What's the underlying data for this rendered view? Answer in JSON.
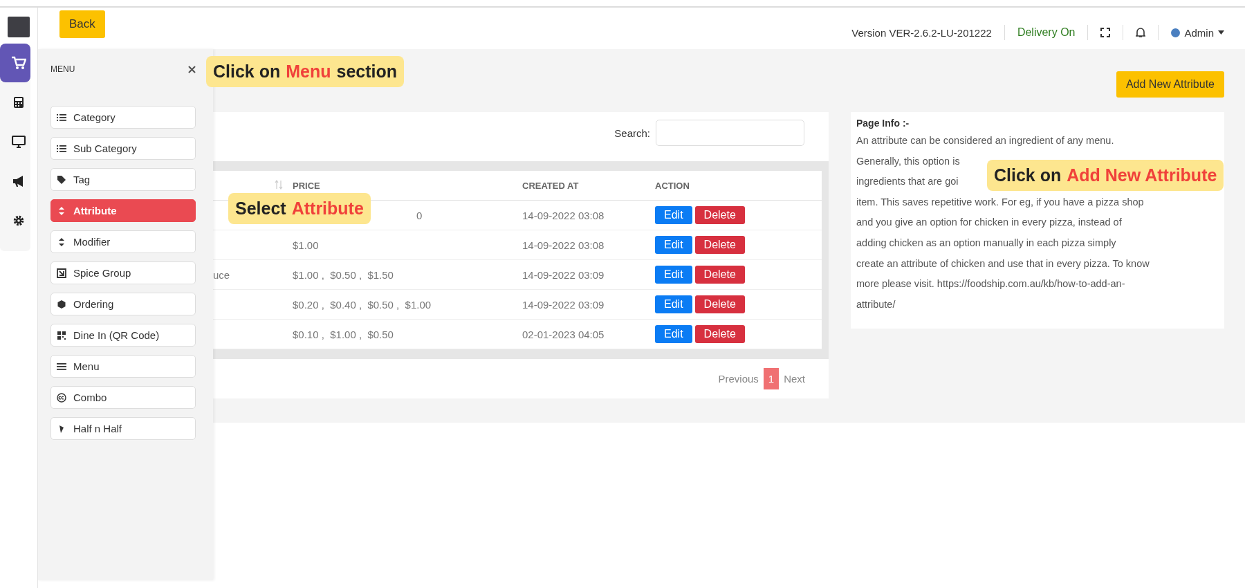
{
  "header": {
    "back_button": "Back",
    "version": "Version VER-2.6.2-LU-201222",
    "delivery_status": "Delivery On",
    "user": "Admin"
  },
  "rail": [
    {
      "selected": true
    },
    {
      "selected": false
    },
    {
      "selected": false
    },
    {
      "selected": false
    },
    {
      "selected": false
    }
  ],
  "drawer": {
    "title": "MENU",
    "items": [
      {
        "label": "Category",
        "selected": false
      },
      {
        "label": "Sub Category",
        "selected": false
      },
      {
        "label": "Tag",
        "selected": false
      },
      {
        "label": "Attribute",
        "selected": true
      },
      {
        "label": "Modifier",
        "selected": false
      },
      {
        "label": "Spice Group",
        "selected": false
      },
      {
        "label": "Ordering",
        "selected": false
      },
      {
        "label": "Dine In (QR Code)",
        "selected": false
      },
      {
        "label": "Menu",
        "selected": false
      },
      {
        "label": "Combo",
        "selected": false
      },
      {
        "label": "Half n Half",
        "selected": false
      }
    ]
  },
  "add_button": "Add New Attribute",
  "table": {
    "search_label": "Search:",
    "columns": [
      "PRICE",
      "CREATED AT",
      "ACTION"
    ],
    "rows": [
      {
        "price": "0",
        "partly_covered": true,
        "created_at": "14-09-2022 03:08",
        "actions": [
          "Edit",
          "Delete"
        ]
      },
      {
        "price": "$1.00",
        "created_at": "14-09-2022 03:08",
        "actions": [
          "Edit",
          "Delete"
        ]
      },
      {
        "column_1": "uce",
        "price": "$1.00 ,  $0.50 ,  $1.50",
        "created_at": "14-09-2022 03:09",
        "actions": [
          "Edit",
          "Delete"
        ]
      },
      {
        "price": "$0.20 ,  $0.40 ,  $0.50 ,  $1.00",
        "created_at": "14-09-2022 03:09",
        "actions": [
          "Edit",
          "Delete"
        ]
      },
      {
        "price": "$0.10 ,  $1.00 ,  $0.50",
        "created_at": "02-01-2023 04:05",
        "actions": [
          "Edit",
          "Delete"
        ]
      }
    ]
  },
  "pagination": {
    "previous": "Previous",
    "pages": [
      {
        "label": "1",
        "selected": true
      }
    ],
    "next": "Next"
  },
  "page_info": {
    "title": "Page Info :-",
    "lines": [
      "An attribute can be considered an ingredient of any menu.",
      "Generally, this option is",
      "ingredients that are goi",
      "item. This saves repetitive work. For eg, if you have a pizza shop",
      "and you give an option for chicken in every pizza, instead of",
      "adding chicken as an option manually in each pizza simply",
      "create an attribute of chicken and use that in every pizza. To know",
      "more please visit. https://foodship.com.au/kb/how-to-add-an-",
      "attribute/"
    ]
  },
  "callouts": [
    {
      "lead": "Click on",
      "highlight": "Menu",
      "tail": "section"
    },
    {
      "lead": "Select",
      "highlight": "Attribute"
    },
    {
      "lead": "Click on",
      "highlight": "Add New Attribute"
    }
  ]
}
